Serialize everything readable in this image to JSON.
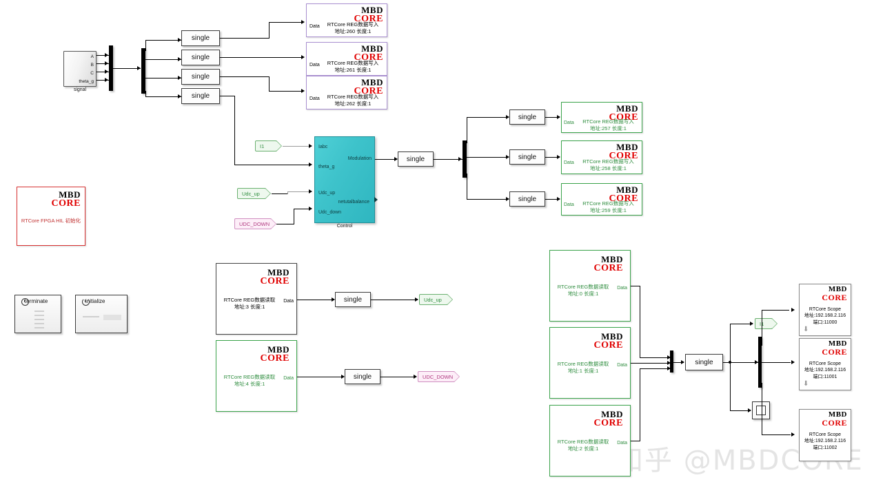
{
  "watermark": "知乎 @MBDCORE",
  "logo": {
    "top": "MBD",
    "bottom": "CORE"
  },
  "source_block": {
    "name": "signal",
    "ports": [
      "A",
      "B",
      "C",
      "theta_g"
    ]
  },
  "control_block": {
    "name": "Control",
    "inputs": [
      "Iabc",
      "theta_g",
      "Udc_up",
      "Udc_down"
    ],
    "outputs": [
      "Modulation",
      "netutalbalance"
    ]
  },
  "convert_label": "single",
  "port_labels": {
    "data": "Data"
  },
  "write_blocks": [
    {
      "id": "w260",
      "title": "RTCore REG数据写入",
      "detail": "地址:260 长度:1",
      "color": "purple"
    },
    {
      "id": "w261",
      "title": "RTCore REG数据写入",
      "detail": "地址:261 长度:1",
      "color": "purple"
    },
    {
      "id": "w262",
      "title": "RTCore REG数据写入",
      "detail": "地址:262 长度:1",
      "color": "purple"
    },
    {
      "id": "w257",
      "title": "RTCore REG数据写入",
      "detail": "地址:257 长度:1",
      "color": "green"
    },
    {
      "id": "w258",
      "title": "RTCore REG数据写入",
      "detail": "地址:258 长度:1",
      "color": "green"
    },
    {
      "id": "w259",
      "title": "RTCore REG数据写入",
      "detail": "地址:259 长度:1",
      "color": "green"
    }
  ],
  "read_blocks": [
    {
      "id": "r3",
      "title": "RTCore REG数据读取",
      "detail": "地址:3 长度:1",
      "color": "white"
    },
    {
      "id": "r4",
      "title": "RTCore REG数据读取",
      "detail": "地址:4 长度:1",
      "color": "green"
    },
    {
      "id": "r0",
      "title": "RTCore REG数据读取",
      "detail": "地址:0 长度:1",
      "color": "green"
    },
    {
      "id": "r1",
      "title": "RTCore REG数据读取",
      "detail": "地址:1 长度:1",
      "color": "green"
    },
    {
      "id": "r2",
      "title": "RTCore REG数据读取",
      "detail": "地址:2 长度:1",
      "color": "green"
    }
  ],
  "init_block": {
    "title": "RTCore FPGA HIL 初始化",
    "color": "red"
  },
  "scope_blocks": [
    {
      "id": "s0",
      "title": "RTCore Scope",
      "address": "地址:192.168.2.116",
      "port": "端口:11000"
    },
    {
      "id": "s1",
      "title": "RTCore Scope",
      "address": "地址:192.168.2.116",
      "port": "端口:11001"
    },
    {
      "id": "s2",
      "title": "RTCore Scope",
      "address": "地址:192.168.2.116",
      "port": "端口:11002"
    }
  ],
  "function_blocks": [
    {
      "id": "terminate",
      "label": "terminate"
    },
    {
      "id": "initialize",
      "label": "initialize"
    }
  ],
  "tags": {
    "iabc_from": "I1",
    "udc_up_from": "Udc_up",
    "udc_down_from": "UDC_DOWN",
    "udc_up_goto": "Udc_up",
    "udc_down_goto": "UDC_DOWN",
    "feedback_goto": "I1"
  },
  "colors": {
    "purple": "#a98fd0",
    "green": "#3aa34a",
    "red": "#d83030",
    "teal": "#3ec3cb",
    "logo_red": "#e00000"
  }
}
